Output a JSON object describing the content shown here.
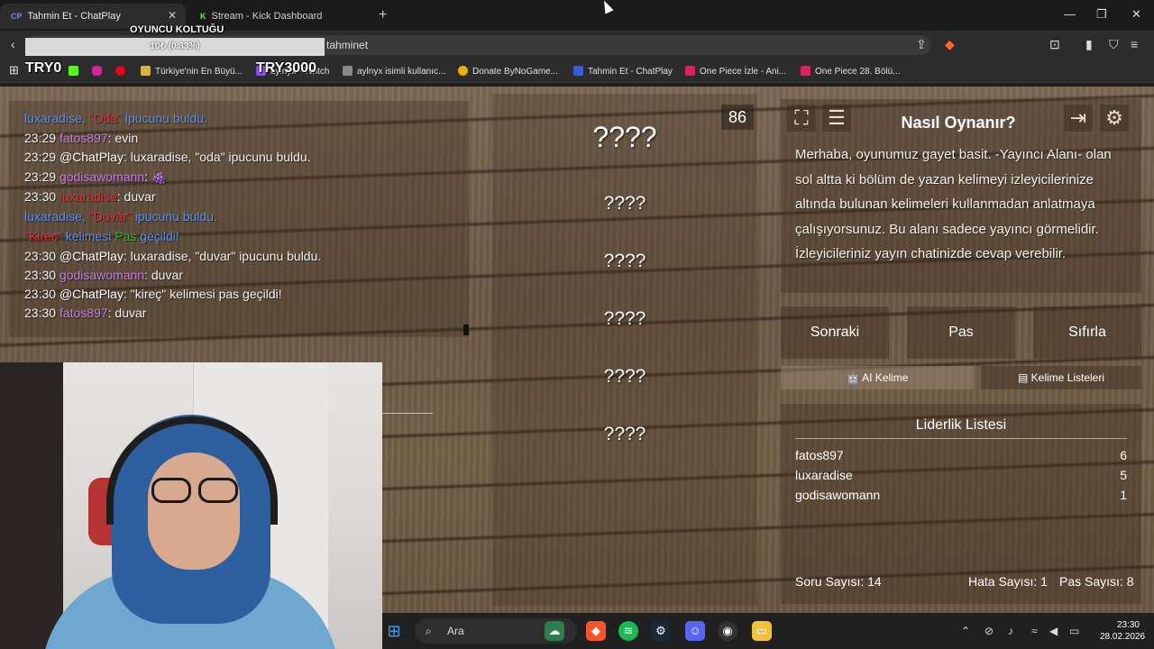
{
  "browser": {
    "tabs": [
      {
        "favicon": "CP",
        "title": "Tahmin Et - ChatPlay",
        "active": true
      },
      {
        "favicon": "K",
        "title": "Stream - Kick Dashboard",
        "active": false
      }
    ],
    "address": "tahminet",
    "bookmarks": [
      {
        "label": "Türkiye'nin En Büyü..."
      },
      {
        "label": "aylnyx - Twitch"
      },
      {
        "label": "aylnyx isimli kullanıc..."
      },
      {
        "label": "Donate ByNoGame..."
      },
      {
        "label": "Tahmin Et - ChatPlay"
      },
      {
        "label": "One Piece İzle - Ani..."
      },
      {
        "label": "One Piece 28. Bölü..."
      }
    ]
  },
  "overlay": {
    "chair_label": "OYUNCU KOLTUĞU",
    "progress_text": "10₺ (0.33%)",
    "progress_fraction": 0.0033,
    "left_label": "TRY0",
    "right_label": "TRY3000"
  },
  "chat": [
    {
      "time": "23:29",
      "user": "luxaradise",
      "user_cls": "u-luxa",
      "parts": [
        {
          "t": ", ",
          "c": "u-luxa"
        },
        {
          "t": "\"Oda\"",
          "c": "c-red"
        },
        {
          "t": " ipucunu buldu.",
          "c": "u-luxa"
        }
      ],
      "notime": true
    },
    {
      "time": "23:29",
      "user": "fatos897",
      "user_cls": "u-fatos",
      "msg": ": evin"
    },
    {
      "time": "23:29",
      "user": "@ChatPlay",
      "user_cls": "u-chat",
      "msg": ": luxaradise, \"oda\" ipucunu buldu."
    },
    {
      "time": "23:29",
      "user": "godisawomann",
      "user_cls": "u-godi",
      "msg": ": 🍇"
    },
    {
      "time": "23:30",
      "user": "luxaradise",
      "user_cls": "c-red",
      "msg": ": duvar"
    },
    {
      "time": "",
      "user": "luxaradise",
      "user_cls": "u-luxa",
      "parts": [
        {
          "t": ", ",
          "c": "u-luxa"
        },
        {
          "t": "\"Duvar\"",
          "c": "c-red"
        },
        {
          "t": " ipucunu buldu.",
          "c": "u-luxa"
        }
      ],
      "notime": true
    },
    {
      "time": "",
      "user": "\"Kireç\"",
      "user_cls": "c-red",
      "parts": [
        {
          "t": " kelimesi ",
          "c": "u-luxa"
        },
        {
          "t": "Pas",
          "c": "c-green"
        },
        {
          "t": " geçildi!",
          "c": "u-luxa"
        }
      ],
      "notime": true
    },
    {
      "time": "23:30",
      "user": "@ChatPlay",
      "user_cls": "u-chat",
      "msg": ": luxaradise, \"duvar\" ipucunu buldu."
    },
    {
      "time": "23:30",
      "user": "godisawomann",
      "user_cls": "u-godi",
      "msg": ": duvar"
    },
    {
      "time": "23:30",
      "user": "@ChatPlay",
      "user_cls": "u-chat",
      "msg": ": \"kireç\" kelimesi pas geçildi!"
    },
    {
      "time": "23:30",
      "user": "fatos897",
      "user_cls": "u-fatos",
      "msg": ": duvar"
    }
  ],
  "game": {
    "timer": "86",
    "main_word": "????",
    "forbidden": [
      "????",
      "????",
      "????",
      "????",
      "????"
    ],
    "howto_title": "Nasıl Oynanır?",
    "howto_text": "Merhaba, oyunumuz gayet basit. -Yayıncı Alanı- olan sol altta ki bölüm de yazan kelimeyi izleyicilerinize altında bulunan kelimeleri kullanmadan anlatmaya çalışıyorsunuz. Bu alanı sadece yayıncı görmelidir. İzleyicileriniz yayın chatinizde cevap verebilir.",
    "buttons": {
      "next": "Sonraki",
      "pass": "Pas",
      "reset": "Sıfırla"
    },
    "tabs": {
      "ai": "AI Kelime",
      "lists": "Kelime Listeleri"
    },
    "leaderboard_title": "Liderlik Listesi",
    "leaderboard": [
      {
        "name": "fatos897",
        "score": "6"
      },
      {
        "name": "luxaradise",
        "score": "5"
      },
      {
        "name": "godisawomann",
        "score": "1"
      }
    ],
    "stats": {
      "questions": "Soru Sayısı: 14",
      "errors": "Hata Sayısı: 1",
      "passes": "Pas Sayısı: 8"
    }
  },
  "taskbar": {
    "search": "Ara",
    "time": "23:30",
    "date": "28.02.2026"
  }
}
